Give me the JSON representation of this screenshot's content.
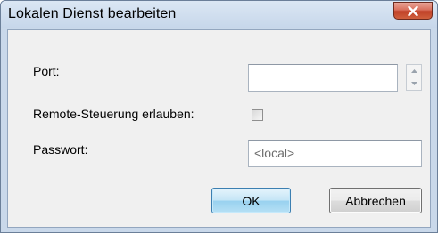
{
  "window": {
    "title": "Lokalen Dienst bearbeiten",
    "close_icon": "close-icon"
  },
  "form": {
    "port_label": "Port:",
    "port_value": "",
    "remote_label": "Remote-Steuerung erlauben:",
    "remote_checked": false,
    "password_label": "Passwort:",
    "password_value": "<local>"
  },
  "buttons": {
    "ok_label": "OK",
    "cancel_label": "Abbrechen"
  },
  "colors": {
    "close_button": "#c04128",
    "ok_button_border": "#3c7fb1"
  }
}
